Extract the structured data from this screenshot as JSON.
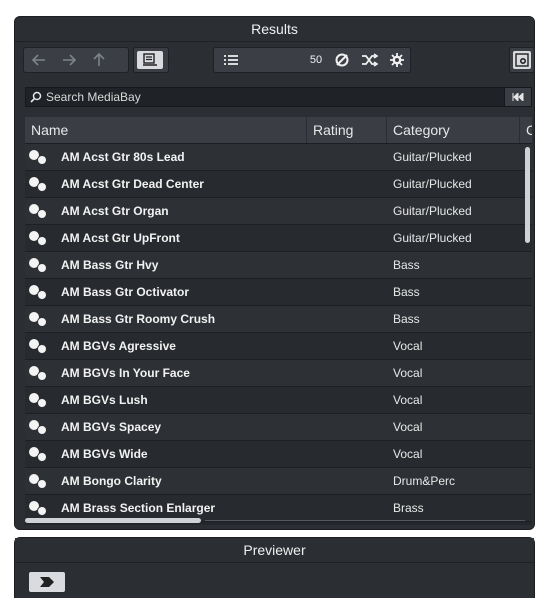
{
  "results": {
    "title": "Results",
    "toolbar": {
      "back_icon": "arrow-left-icon",
      "forward_icon": "arrow-right-icon",
      "up_icon": "arrow-up-icon",
      "location_icon": "folder-list-icon",
      "list_icon": "list-icon",
      "count": "50",
      "refresh_icon": "no-sync-icon",
      "shuffle_icon": "shuffle-icon",
      "settings_icon": "gear-icon",
      "setup_icon": "window-gear-icon"
    },
    "search": {
      "placeholder": "Search MediaBay",
      "reset_icon": "rewind-icon"
    },
    "columns": [
      "Name",
      "Rating",
      "Category",
      "C"
    ],
    "rows": [
      {
        "name": "AM Acst Gtr 80s Lead",
        "category": "Guitar/Plucked"
      },
      {
        "name": "AM Acst Gtr Dead Center",
        "category": "Guitar/Plucked"
      },
      {
        "name": "AM Acst Gtr Organ",
        "category": "Guitar/Plucked"
      },
      {
        "name": "AM Acst Gtr UpFront",
        "category": "Guitar/Plucked"
      },
      {
        "name": "AM Bass Gtr Hvy",
        "category": "Bass"
      },
      {
        "name": "AM Bass Gtr Octivator",
        "category": "Bass"
      },
      {
        "name": "AM Bass Gtr Roomy Crush",
        "category": "Bass"
      },
      {
        "name": "AM BGVs Agressive",
        "category": "Vocal"
      },
      {
        "name": "AM BGVs In Your Face",
        "category": "Vocal"
      },
      {
        "name": "AM BGVs Lush",
        "category": "Vocal"
      },
      {
        "name": "AM BGVs Spacey",
        "category": "Vocal"
      },
      {
        "name": "AM BGVs Wide",
        "category": "Vocal"
      },
      {
        "name": "AM Bongo Clarity",
        "category": "Drum&Perc"
      },
      {
        "name": "AM Brass Section Enlarger",
        "category": "Brass"
      }
    ]
  },
  "previewer": {
    "title": "Previewer",
    "button_icon": "insert-arrow-icon"
  },
  "colors": {
    "panel_bg": "#2b2e33",
    "row_odd": "#2d3035",
    "row_even": "#272a2e",
    "header_bg": "#3a3e44",
    "button_light": "#d9dbde"
  }
}
